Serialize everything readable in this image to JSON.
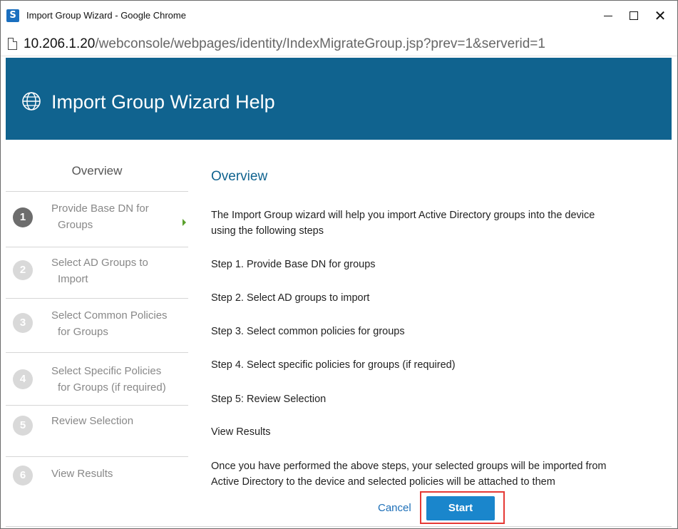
{
  "window": {
    "title": "Import Group Wizard - Google Chrome",
    "icon_letter": "S",
    "url_host": "10.206.1.20",
    "url_path": "/webconsole/webpages/identity/IndexMigrateGroup.jsp?prev=1&serverid=1"
  },
  "header": {
    "title": "Import Group Wizard Help",
    "icon": "globe-icon",
    "background_color": "#10638f"
  },
  "sidebar": {
    "title": "Overview",
    "steps": [
      {
        "num": "1",
        "line1": "Provide Base DN for",
        "line2": "Groups",
        "active": true
      },
      {
        "num": "2",
        "line1": "Select AD Groups to",
        "line2": "Import",
        "active": false
      },
      {
        "num": "3",
        "line1": "Select Common Policies",
        "line2": "for Groups",
        "active": false
      },
      {
        "num": "4",
        "line1": "Select Specific Policies",
        "line2": "for Groups (if required)",
        "active": false
      },
      {
        "num": "5",
        "line1": "Review Selection",
        "line2": "",
        "active": false
      },
      {
        "num": "6",
        "line1": "View Results",
        "line2": "",
        "active": false
      }
    ]
  },
  "main": {
    "title": "Overview",
    "intro_line1": "The Import Group wizard will help you import Active Directory groups into the device",
    "intro_line2": "using the following steps",
    "steps": [
      "Step 1. Provide Base DN for groups",
      "Step 2. Select AD groups to import",
      "Step 3. Select common policies for groups",
      "Step 4. Select specific policies for groups (if required)",
      "Step 5: Review Selection",
      "View Results"
    ],
    "outro_line1": "Once you have performed the above steps, your selected groups will be imported from",
    "outro_line2": "Active Directory to the device and selected policies will be attached to them"
  },
  "actions": {
    "cancel_label": "Cancel",
    "start_label": "Start",
    "start_color": "#1a86cc",
    "highlight_color": "#e53935"
  }
}
